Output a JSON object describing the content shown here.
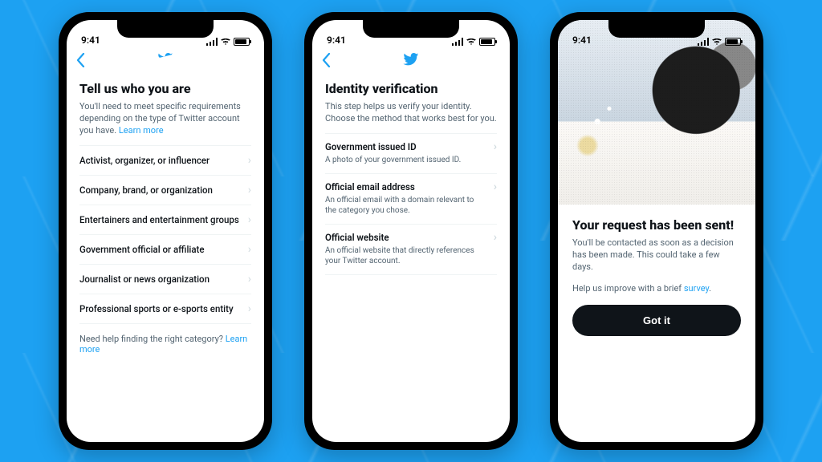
{
  "status_bar": {
    "time": "9:41"
  },
  "phone1": {
    "title": "Tell us who you are",
    "subtitle": "You'll need to meet specific requirements depending on the type of Twitter account you have. ",
    "learn_more": "Learn more",
    "categories": [
      "Activist, organizer, or influencer",
      "Company, brand, or organization",
      "Entertainers and entertainment groups",
      "Government official or affiliate",
      "Journalist or news organization",
      "Professional sports or e-sports entity"
    ],
    "help_prefix": "Need help finding the right category? ",
    "help_link": "Learn more"
  },
  "phone2": {
    "title": "Identity verification",
    "subtitle": "This step helps us verify your identity. Choose the method that works best for you.",
    "options": [
      {
        "title": "Government issued ID",
        "desc": "A photo of your government issued ID."
      },
      {
        "title": "Official email address",
        "desc": "An official email with a domain relevant to the category you chose."
      },
      {
        "title": "Official website",
        "desc": "An official website that directly references your Twitter account."
      }
    ]
  },
  "phone3": {
    "title": "Your request has been sent!",
    "subtitle": "You'll be contacted as soon as a decision has been made. This could take a few days.",
    "survey_prefix": "Help us improve with a brief ",
    "survey_link": "survey",
    "survey_suffix": ".",
    "button": "Got it"
  }
}
